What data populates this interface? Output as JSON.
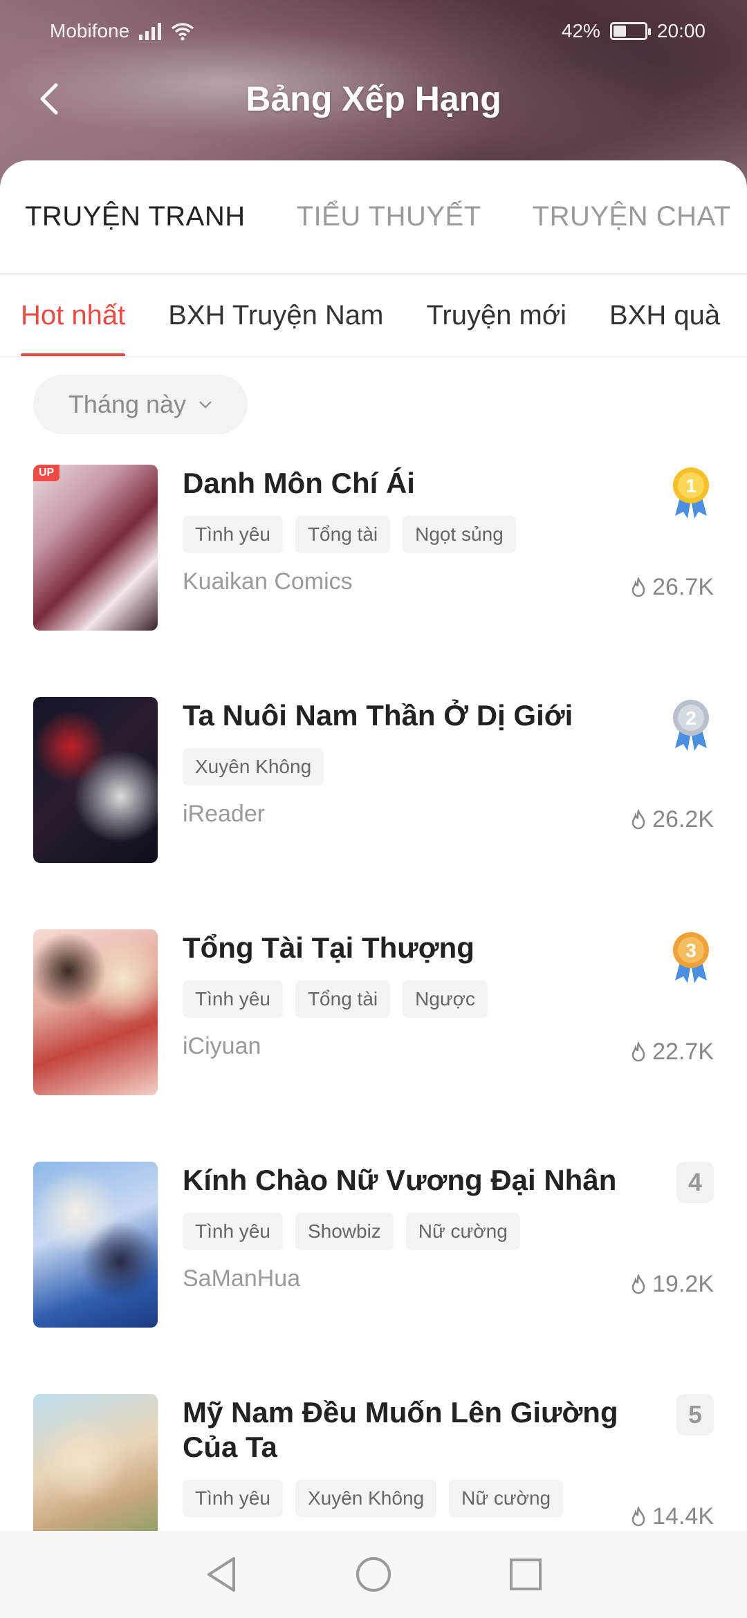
{
  "status_bar": {
    "carrier": "Mobifone",
    "battery": "42%",
    "battery_level": 0.42,
    "time": "20:00"
  },
  "header": {
    "title": "Bảng Xếp Hạng",
    "back_icon": "chevron-left-icon"
  },
  "main_tabs": [
    {
      "label": "TRUYỆN TRANH",
      "active": true
    },
    {
      "label": "TIỂU THUYẾT",
      "active": false
    },
    {
      "label": "TRUYỆN CHAT",
      "active": false
    }
  ],
  "sub_tabs": [
    {
      "label": "Hot nhất",
      "active": true
    },
    {
      "label": "BXH Truyện Nam",
      "active": false
    },
    {
      "label": "Truyện mới",
      "active": false
    },
    {
      "label": "BXH quà",
      "active": false
    }
  ],
  "filter": {
    "label": "Tháng này",
    "icon": "chevron-down-icon"
  },
  "colors": {
    "accent": "#ea4a44",
    "gold": "#f5c02a",
    "silver": "#b9c2cc",
    "bronze": "#f0a23a",
    "ribbon": "#4a8fe0"
  },
  "items": [
    {
      "rank": "1",
      "title": "Danh Môn Chí Ái",
      "tags": [
        "Tình yêu",
        "Tổng tài",
        "Ngọt sủng"
      ],
      "source": "Kuaikan Comics",
      "views": "26.7K",
      "badge": "UP",
      "medal": "gold"
    },
    {
      "rank": "2",
      "title": "Ta Nuôi Nam Thần Ở Dị Giới",
      "tags": [
        "Xuyên Không"
      ],
      "source": "iReader",
      "views": "26.2K",
      "medal": "silver"
    },
    {
      "rank": "3",
      "title": "Tổng Tài Tại Thượng",
      "tags": [
        "Tình yêu",
        "Tổng tài",
        "Ngược"
      ],
      "source": "iCiyuan",
      "views": "22.7K",
      "medal": "bronze"
    },
    {
      "rank": "4",
      "title": "Kính Chào Nữ Vương Đại Nhân",
      "tags": [
        "Tình yêu",
        "Showbiz",
        "Nữ cường"
      ],
      "source": "SaManHua",
      "views": "19.2K"
    },
    {
      "rank": "5",
      "title": "Mỹ Nam Đều Muốn Lên Giường Của Ta",
      "tags": [
        "Tình yêu",
        "Xuyên Không",
        "Nữ cường"
      ],
      "source": "",
      "views": "14.4K"
    }
  ]
}
